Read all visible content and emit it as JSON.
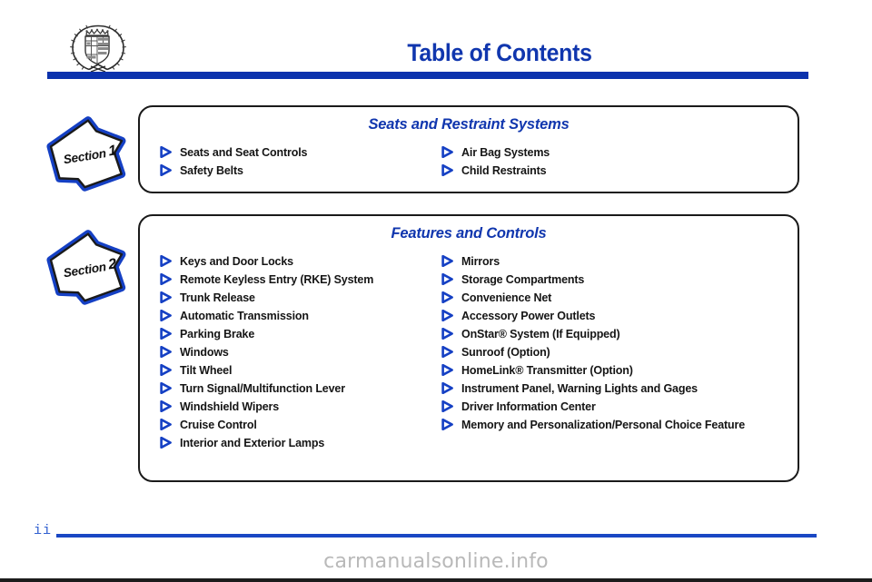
{
  "header": {
    "logo_icon": "cadillac-crest-icon",
    "title": "Table of Contents"
  },
  "sections": [
    {
      "badge_word": "Section",
      "badge_number": "1",
      "heading": "Seats and Restraint Systems",
      "left_items": [
        "Seats and Seat Controls",
        "Safety Belts"
      ],
      "right_items": [
        "Air Bag Systems",
        "Child Restraints"
      ]
    },
    {
      "badge_word": "Section",
      "badge_number": "2",
      "heading": "Features and Controls",
      "left_items": [
        "Keys and Door Locks",
        "Remote Keyless Entry (RKE) System",
        "Trunk Release",
        "Automatic Transmission",
        "Parking Brake",
        "Windows",
        "Tilt Wheel",
        "Turn Signal/Multifunction Lever",
        "Windshield Wipers",
        "Cruise Control",
        "Interior and Exterior Lamps"
      ],
      "right_items": [
        "Mirrors",
        "Storage Compartments",
        "Convenience Net",
        "Accessory Power Outlets",
        "OnStar® System (If Equipped)",
        "Sunroof (Option)",
        "HomeLink® Transmitter (Option)",
        "Instrument Panel, Warning Lights and Gages",
        "Driver Information Center",
        "Memory and Personalization/Personal Choice Feature"
      ]
    }
  ],
  "footer": {
    "page_number": "ii",
    "watermark": "carmanualsonline.info"
  },
  "colors": {
    "brand_blue": "#0b32ad",
    "heading_blue": "#1036ae",
    "marker_blue": "#1540c4",
    "text_black": "#151515",
    "watermark_gray": "#b9b9b9"
  }
}
